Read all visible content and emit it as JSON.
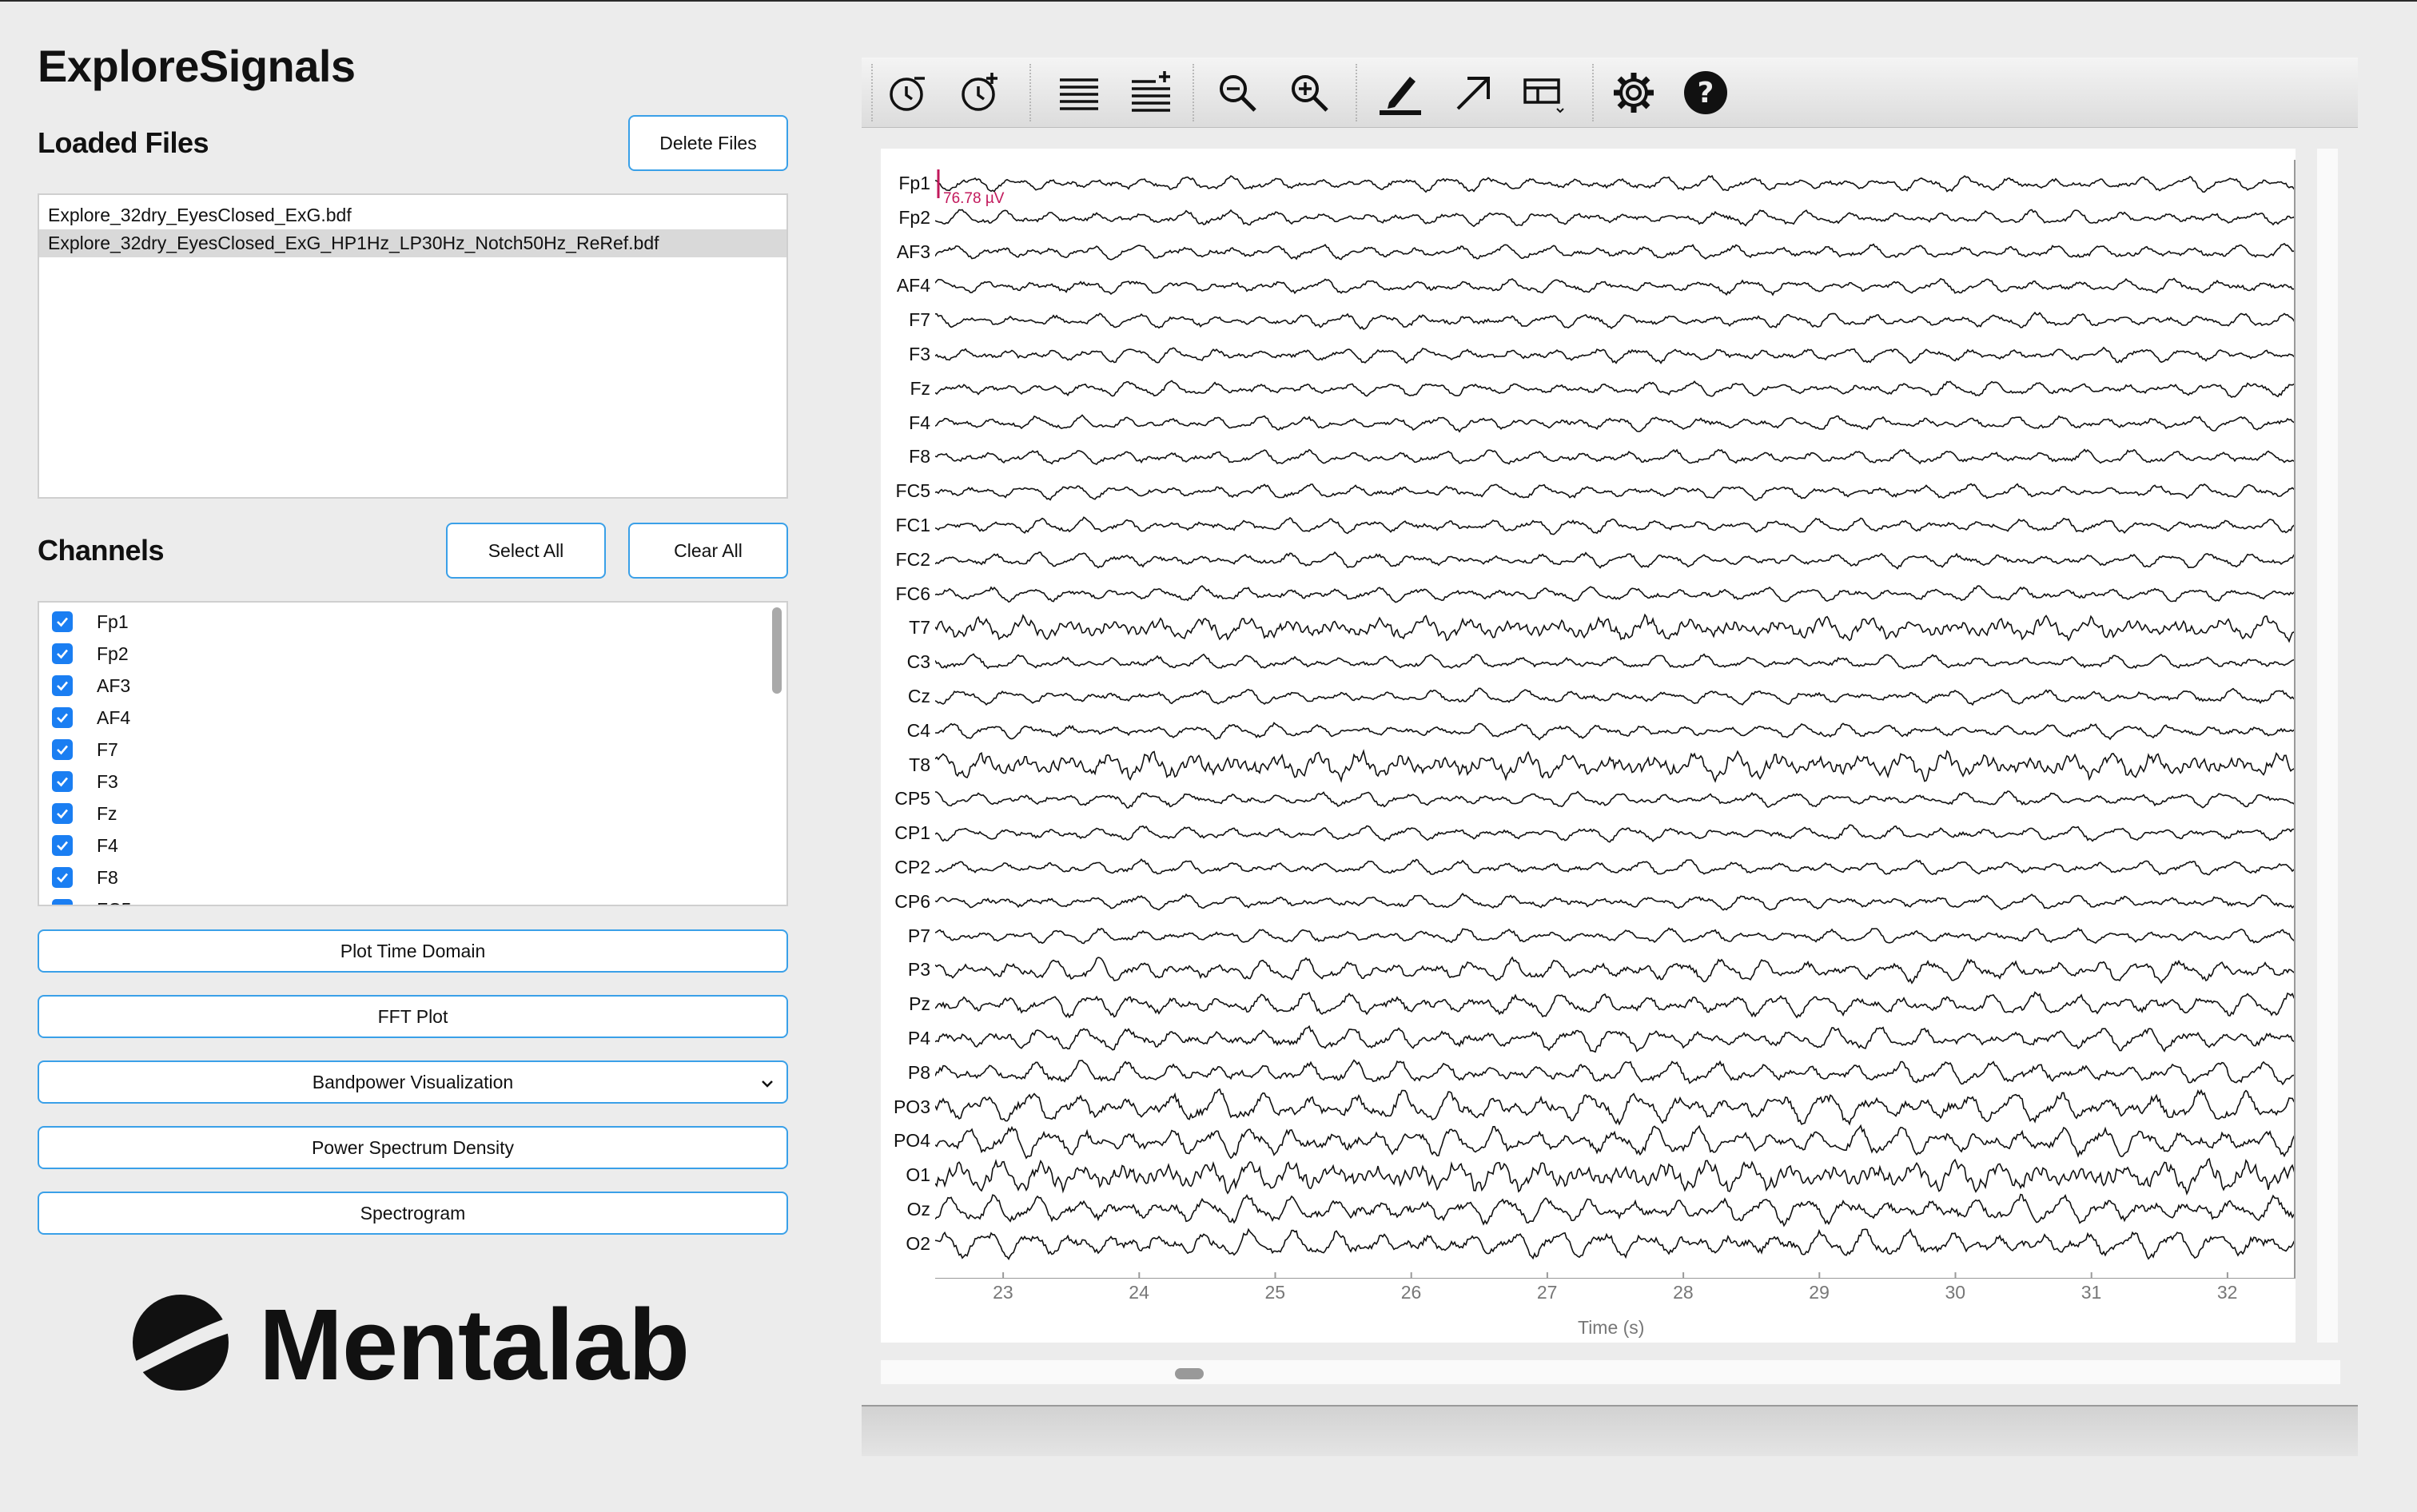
{
  "app": {
    "title": "ExploreSignals"
  },
  "loaded_files": {
    "title": "Loaded Files",
    "delete_label": "Delete Files",
    "files": [
      {
        "name": "Explore_32dry_EyesClosed_ExG.bdf",
        "selected": false
      },
      {
        "name": "Explore_32dry_EyesClosed_ExG_HP1Hz_LP30Hz_Notch50Hz_ReRef.bdf",
        "selected": true
      }
    ]
  },
  "channels_panel": {
    "title": "Channels",
    "select_all_label": "Select All",
    "clear_all_label": "Clear All",
    "items": [
      {
        "label": "Fp1",
        "checked": true
      },
      {
        "label": "Fp2",
        "checked": true
      },
      {
        "label": "AF3",
        "checked": true
      },
      {
        "label": "AF4",
        "checked": true
      },
      {
        "label": "F7",
        "checked": true
      },
      {
        "label": "F3",
        "checked": true
      },
      {
        "label": "Fz",
        "checked": true
      },
      {
        "label": "F4",
        "checked": true
      },
      {
        "label": "F8",
        "checked": true
      },
      {
        "label": "FC5",
        "checked": true
      }
    ]
  },
  "actions": {
    "plot_time_domain": "Plot Time Domain",
    "fft_plot": "FFT Plot",
    "bandpower": "Bandpower Visualization",
    "psd": "Power Spectrum Density",
    "spectrogram": "Spectrogram"
  },
  "brand": {
    "name": "Mentalab"
  },
  "toolbar": {
    "icons": [
      "clock-minus-icon",
      "clock-plus-icon",
      "lines-icon",
      "lines-plus-icon",
      "zoom-out-icon",
      "zoom-in-icon",
      "pen-icon",
      "arrow-icon",
      "layout-icon",
      "gear-icon",
      "help-icon"
    ]
  },
  "plot": {
    "scale_label": "76.78 µV",
    "accent_color": "#c2185b",
    "channel_labels": [
      "Fp1",
      "Fp2",
      "AF3",
      "AF4",
      "F7",
      "F3",
      "Fz",
      "F4",
      "F8",
      "FC5",
      "FC1",
      "FC2",
      "FC6",
      "T7",
      "C3",
      "Cz",
      "C4",
      "T8",
      "CP5",
      "CP1",
      "CP2",
      "CP6",
      "P7",
      "P3",
      "Pz",
      "P4",
      "P8",
      "PO3",
      "PO4",
      "O1",
      "Oz",
      "O2"
    ],
    "x_ticks": [
      "23",
      "24",
      "25",
      "26",
      "27",
      "28",
      "29",
      "30",
      "31",
      "32"
    ],
    "x_label": "Time (s)"
  },
  "chart_data": {
    "type": "line",
    "title": "",
    "xlabel": "Time (s)",
    "ylabel": "",
    "xlim": [
      22.5,
      32.5
    ],
    "x_ticks": [
      23,
      24,
      25,
      26,
      27,
      28,
      29,
      30,
      31,
      32
    ],
    "grid": false,
    "series": [
      {
        "name": "Fp1"
      },
      {
        "name": "Fp2"
      },
      {
        "name": "AF3"
      },
      {
        "name": "AF4"
      },
      {
        "name": "F7"
      },
      {
        "name": "F3"
      },
      {
        "name": "Fz"
      },
      {
        "name": "F4"
      },
      {
        "name": "F8"
      },
      {
        "name": "FC5"
      },
      {
        "name": "FC1"
      },
      {
        "name": "FC2"
      },
      {
        "name": "FC6"
      },
      {
        "name": "T7"
      },
      {
        "name": "C3"
      },
      {
        "name": "Cz"
      },
      {
        "name": "C4"
      },
      {
        "name": "T8"
      },
      {
        "name": "CP5"
      },
      {
        "name": "CP1"
      },
      {
        "name": "CP2"
      },
      {
        "name": "CP6"
      },
      {
        "name": "P7"
      },
      {
        "name": "P3"
      },
      {
        "name": "Pz"
      },
      {
        "name": "P4"
      },
      {
        "name": "P8"
      },
      {
        "name": "PO3"
      },
      {
        "name": "PO4"
      },
      {
        "name": "O1"
      },
      {
        "name": "Oz"
      },
      {
        "name": "O2"
      }
    ]
  }
}
